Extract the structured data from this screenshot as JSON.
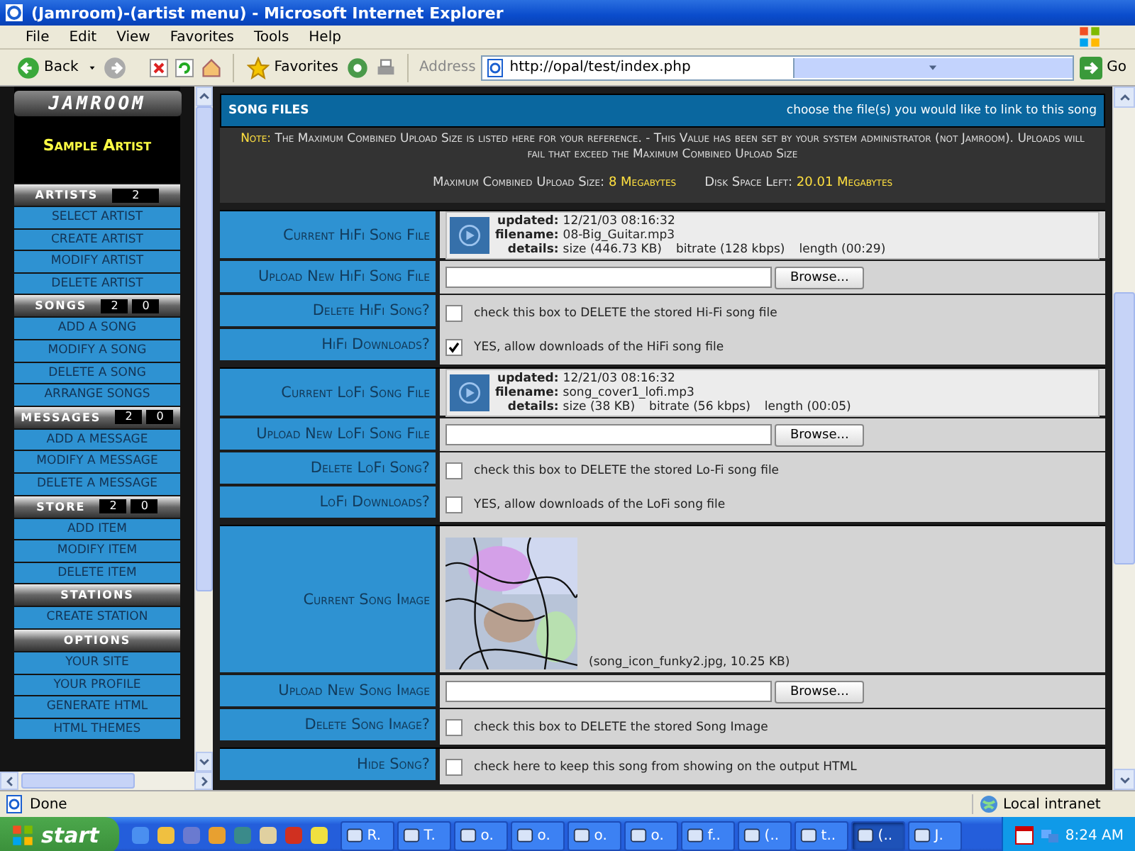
{
  "window": {
    "title": "(Jamroom)-(artist menu) - Microsoft Internet Explorer"
  },
  "menu": [
    "File",
    "Edit",
    "View",
    "Favorites",
    "Tools",
    "Help"
  ],
  "toolbar": {
    "back": "Back",
    "favorites": "Favorites",
    "address_label": "Address",
    "address": "http://opal/test/index.php",
    "go": "Go"
  },
  "sidebar": {
    "logo": "JAMROOM",
    "artist": "Sample Artist",
    "sections": [
      {
        "title": "ARTISTS",
        "counts": [
          "2"
        ],
        "items": [
          "SELECT ARTIST",
          "CREATE ARTIST",
          "MODIFY ARTIST",
          "DELETE ARTIST"
        ]
      },
      {
        "title": "SONGS",
        "counts": [
          "2",
          "0"
        ],
        "items": [
          "ADD A SONG",
          "MODIFY A SONG",
          "DELETE A SONG",
          "ARRANGE SONGS"
        ]
      },
      {
        "title": "MESSAGES",
        "counts": [
          "2",
          "0"
        ],
        "items": [
          "ADD A MESSAGE",
          "MODIFY A MESSAGE",
          "DELETE A MESSAGE"
        ]
      },
      {
        "title": "STORE",
        "counts": [
          "2",
          "0"
        ],
        "items": [
          "ADD ITEM",
          "MODIFY ITEM",
          "DELETE ITEM"
        ]
      },
      {
        "title": "STATIONS",
        "items": [
          "CREATE STATION"
        ]
      },
      {
        "title": "OPTIONS",
        "items": [
          "YOUR SITE",
          "YOUR PROFILE",
          "GENERATE HTML",
          "HTML THEMES"
        ]
      }
    ]
  },
  "song_files": {
    "title": "SONG FILES",
    "hint": "choose the file(s) you would like to link to this song",
    "note_label": "Note:",
    "note": "The Maximum Combined Upload Size is listed here for your reference. - This Value has been set by your system administrator (not Jamroom). Uploads will fail that exceed the Maximum Combined Upload Size",
    "max_label": "Maximum Combined Upload Size:",
    "max_value": "8 Megabytes",
    "disk_label": "Disk Space Left:",
    "disk_value": "20.01 Megabytes",
    "groups": [
      [
        {
          "kind": "file",
          "label": "Current HiFi Song File",
          "updated_label": "updated:",
          "updated": "12/21/03 08:16:32",
          "filename_label": "filename:",
          "filename": "08-Big_Guitar.mp3",
          "details_label": "details:",
          "details": [
            "size (446.73 KB)",
            "bitrate (128 kbps)",
            "length (00:29)"
          ]
        },
        {
          "kind": "upload",
          "label": "Upload New HiFi Song File",
          "button": "Browse..."
        },
        {
          "kind": "check",
          "label": "Delete HiFi Song?",
          "checked": false,
          "text": "check this box to DELETE the stored Hi-Fi song file"
        },
        {
          "kind": "check",
          "label": "HiFi Downloads?",
          "checked": true,
          "text": "YES, allow downloads of the HiFi song file"
        }
      ],
      [
        {
          "kind": "file",
          "label": "Current LoFi Song File",
          "updated_label": "updated:",
          "updated": "12/21/03 08:16:32",
          "filename_label": "filename:",
          "filename": "song_cover1_lofi.mp3",
          "details_label": "details:",
          "details": [
            "size (38 KB)",
            "bitrate (56 kbps)",
            "length (00:05)"
          ]
        },
        {
          "kind": "upload",
          "label": "Upload New LoFi Song File",
          "button": "Browse..."
        },
        {
          "kind": "check",
          "label": "Delete LoFi Song?",
          "checked": false,
          "text": "check this box to DELETE the stored Lo-Fi song file"
        },
        {
          "kind": "check",
          "label": "LoFi Downloads?",
          "checked": false,
          "text": "YES, allow downloads of the LoFi song file"
        }
      ],
      [
        {
          "kind": "image",
          "label": "Current Song Image",
          "caption": "(song_icon_funky2.jpg, 10.25 KB)"
        },
        {
          "kind": "upload",
          "label": "Upload New Song Image",
          "button": "Browse..."
        },
        {
          "kind": "check",
          "label": "Delete Song Image?",
          "checked": false,
          "text": "check this box to DELETE the stored Song Image"
        }
      ],
      [
        {
          "kind": "check",
          "label": "Hide Song?",
          "checked": false,
          "text": "check here to keep this song from showing on the output HTML"
        }
      ]
    ]
  },
  "status_bar": {
    "text": "Done",
    "zone": "Local intranet"
  },
  "taskbar": {
    "start": "start",
    "tasks": [
      {
        "label": "R.",
        "selected": false
      },
      {
        "label": "T.",
        "selected": false
      },
      {
        "label": "o.",
        "selected": false
      },
      {
        "label": "o.",
        "selected": false
      },
      {
        "label": "o.",
        "selected": false
      },
      {
        "label": "o.",
        "selected": false
      },
      {
        "label": "f..",
        "selected": false
      },
      {
        "label": "(..",
        "selected": false
      },
      {
        "label": "t..",
        "selected": false
      },
      {
        "label": "(..",
        "selected": true
      },
      {
        "label": "J.",
        "selected": false
      }
    ],
    "clock": "8:24 AM"
  }
}
